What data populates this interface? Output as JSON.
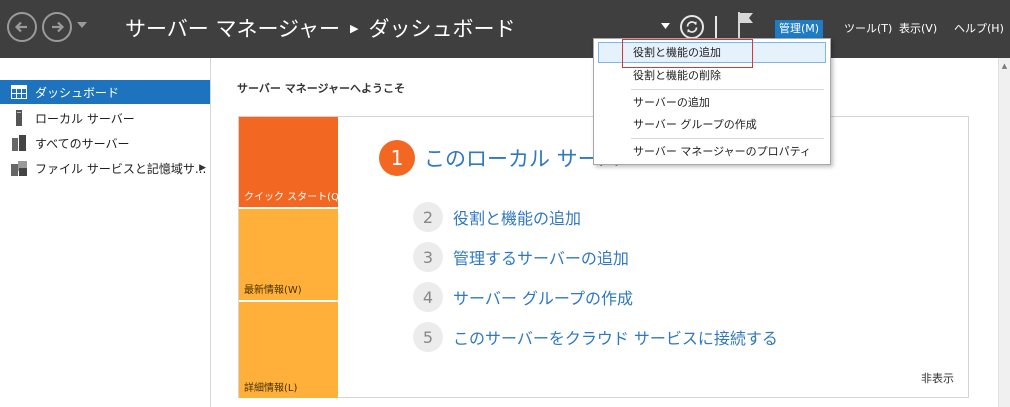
{
  "window": {
    "breadcrumb_app": "サーバー マネージャー",
    "breadcrumb_page": "ダッシュボード"
  },
  "menu": {
    "manage": "管理(M)",
    "tools": "ツール(T)",
    "view": "表示(V)",
    "help": "ヘルプ(H)"
  },
  "sidebar": {
    "items": [
      {
        "label": "ダッシュボード"
      },
      {
        "label": "ローカル サーバー"
      },
      {
        "label": "すべてのサーバー"
      },
      {
        "label": "ファイル サービスと記憶域サ..."
      }
    ]
  },
  "main": {
    "welcome": "サーバー マネージャーへようこそ",
    "tiles": {
      "quick_start": "クイック スタート(Q)",
      "whats_new": "最新情報(W)",
      "learn_more": "詳細情報(L)"
    },
    "step1": {
      "num": "1",
      "label": "このローカル サーバー"
    },
    "steps": [
      {
        "num": "2",
        "label": "役割と機能の追加"
      },
      {
        "num": "3",
        "label": "管理するサーバーの追加"
      },
      {
        "num": "4",
        "label": "サーバー グループの作成"
      },
      {
        "num": "5",
        "label": "このサーバーをクラウド サービスに接続する"
      }
    ],
    "hide": "非表示"
  },
  "dropdown": {
    "items": [
      {
        "label": "役割と機能の追加"
      },
      {
        "label": "役割と機能の削除"
      },
      {
        "label": "サーバーの追加"
      },
      {
        "label": "サーバー グループの作成"
      },
      {
        "label": "サーバー マネージャーのプロパティ"
      }
    ]
  },
  "colors": {
    "titlebar": "#3f3f3f",
    "accent": "#1e73be",
    "quick_start_tile": "#f26722",
    "info_tile": "#ffb03b",
    "link": "#2f78c4"
  }
}
